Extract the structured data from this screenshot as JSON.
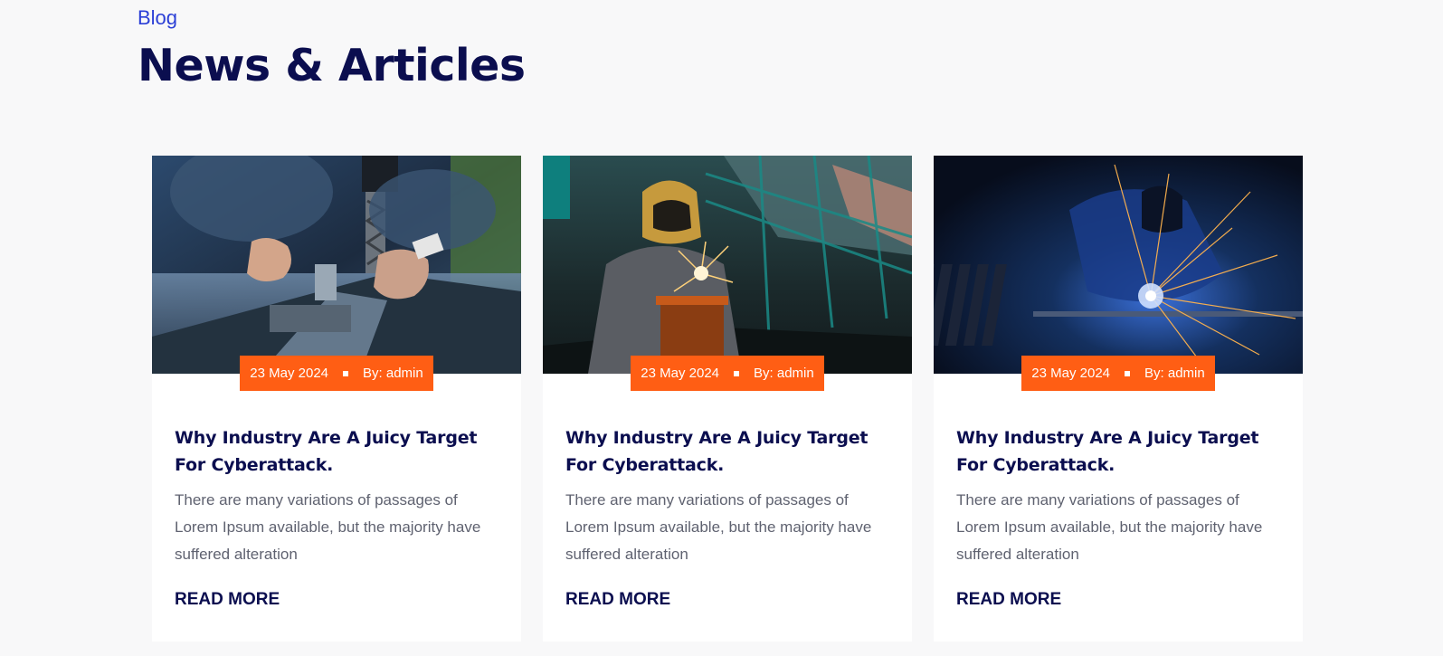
{
  "header": {
    "eyebrow": "Blog",
    "title": "News & Articles"
  },
  "colors": {
    "accent": "#ff5e14",
    "heading": "#0b0e4f",
    "eyebrow": "#2b3fd6",
    "body_text": "#5f6270",
    "background": "#f8f8f9"
  },
  "cards": [
    {
      "image": "machinist-drilling-photo",
      "date": "23 May 2024",
      "author": "By: admin",
      "title": "Why Industry Are A Juicy Target For Cyberattack.",
      "excerpt": "There are many variations of passages of Lorem Ipsum available, but the majority have suffered alteration",
      "read_more": "READ MORE"
    },
    {
      "image": "welder-in-factory-photo",
      "date": "23 May 2024",
      "author": "By: admin",
      "title": "Why Industry Are A Juicy Target For Cyberattack.",
      "excerpt": "There are many variations of passages of Lorem Ipsum available, but the majority have suffered alteration",
      "read_more": "READ MORE"
    },
    {
      "image": "welder-blue-sparks-photo",
      "date": "23 May 2024",
      "author": "By: admin",
      "title": "Why Industry Are A Juicy Target For Cyberattack.",
      "excerpt": "There are many variations of passages of Lorem Ipsum available, but the majority have suffered alteration",
      "read_more": "READ MORE"
    }
  ]
}
